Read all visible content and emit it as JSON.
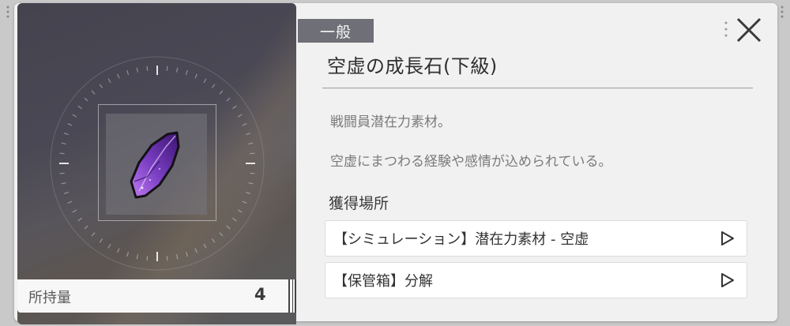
{
  "item": {
    "category": "一般",
    "name": "空虚の成長石(下級)",
    "description_1": "戦闘員潜在力素材。",
    "description_2": "空虚にまつわる経験や感情が込められている。",
    "icon": "purple-crystal-icon"
  },
  "holdings": {
    "label": "所持量",
    "count": "4"
  },
  "sources": {
    "heading": "獲得場所",
    "items": [
      {
        "label": "【シミュレーション】潜在力素材 - 空虚"
      },
      {
        "label": "【保管箱】分解"
      }
    ]
  },
  "colors": {
    "tag_bg": "#6f6f77",
    "panel_bg": "#f1f1f1",
    "crystal": "#7b3fc4"
  }
}
